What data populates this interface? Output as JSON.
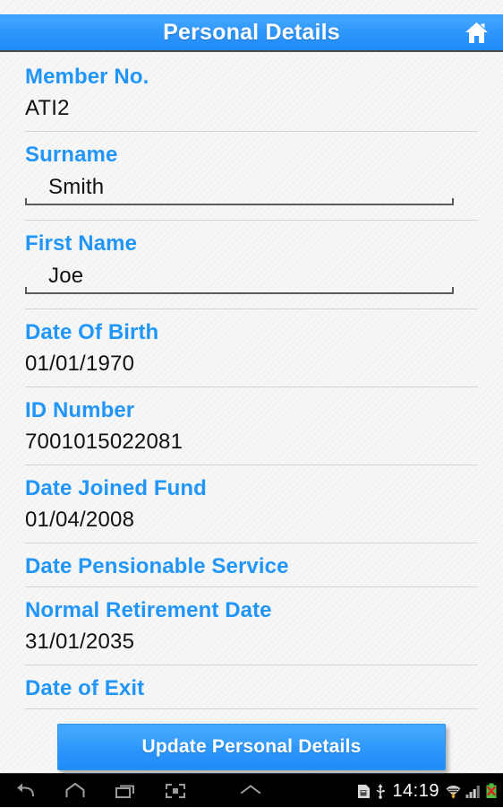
{
  "header": {
    "title": "Personal Details",
    "home_icon": "home-icon",
    "bg_color": "#2e95fb",
    "title_color": "#ffffff"
  },
  "theme": {
    "label_color": "#2196f8",
    "value_color": "#111111",
    "background": "#f7f7f7",
    "divider_color": "#d4d4d4",
    "accent": "#2196f8"
  },
  "form": {
    "fields": [
      {
        "label": "Member No.",
        "value": "ATI2",
        "editable": false
      },
      {
        "label": "Surname",
        "value": "Smith",
        "editable": true,
        "placeholder": ""
      },
      {
        "label": "First Name",
        "value": "Joe",
        "editable": true,
        "placeholder": ""
      },
      {
        "label": "Date Of Birth",
        "value": "01/01/1970",
        "editable": false
      },
      {
        "label": "ID Number",
        "value": "7001015022081",
        "editable": false
      },
      {
        "label": "Date Joined Fund",
        "value": "01/04/2008",
        "editable": false
      },
      {
        "label": "Date Pensionable Service",
        "value": "",
        "editable": false
      },
      {
        "label": "Normal Retirement Date",
        "value": "31/01/2035",
        "editable": false
      },
      {
        "label": "Date of Exit",
        "value": "",
        "editable": false
      }
    ]
  },
  "actions": {
    "update_label": "Update Personal Details"
  },
  "navbar": {
    "buttons": [
      {
        "name": "back-icon"
      },
      {
        "name": "home-icon"
      },
      {
        "name": "recents-icon"
      },
      {
        "name": "screenshot-icon"
      }
    ],
    "expand_icon": "chevron-up-icon",
    "status": {
      "clock": "14:19",
      "icons": [
        "sd-card-icon",
        "usb-icon",
        "wifi-icon",
        "signal-bars-icon",
        "battery-error-icon"
      ]
    }
  }
}
